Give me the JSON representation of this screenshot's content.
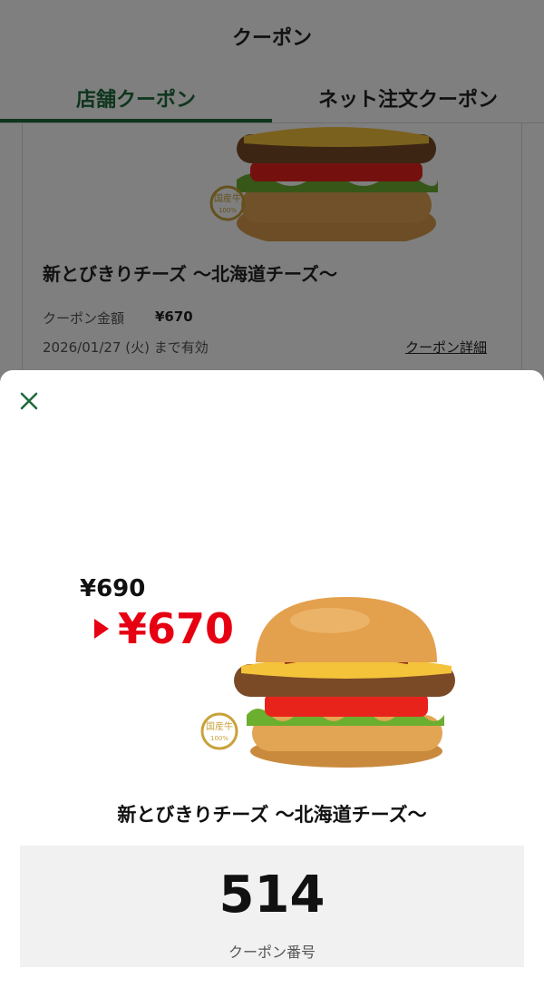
{
  "header": {
    "title": "クーポン"
  },
  "tabs": [
    {
      "label": "店舗クーポン",
      "active": true
    },
    {
      "label": "ネット注文クーポン",
      "active": false
    }
  ],
  "card": {
    "product_name": "新とびきりチーズ 〜北海道チーズ〜",
    "price_label": "クーポン金額",
    "price": "¥670",
    "valid_until": "2026/01/27 (火) まで有効",
    "detail_link": "クーポン詳細"
  },
  "sheet": {
    "close_icon": "close-icon",
    "original_price": "¥690",
    "coupon_price": "¥670",
    "product_name": "新とびきりチーズ 〜北海道チーズ〜",
    "coupon_number": "514",
    "coupon_number_label": "クーポン番号",
    "badge_text": "国産牛",
    "badge_sub": "100%"
  },
  "colors": {
    "accent": "#1d6b3b",
    "price_red": "#e60012",
    "code_bg": "#f1f1f1"
  }
}
